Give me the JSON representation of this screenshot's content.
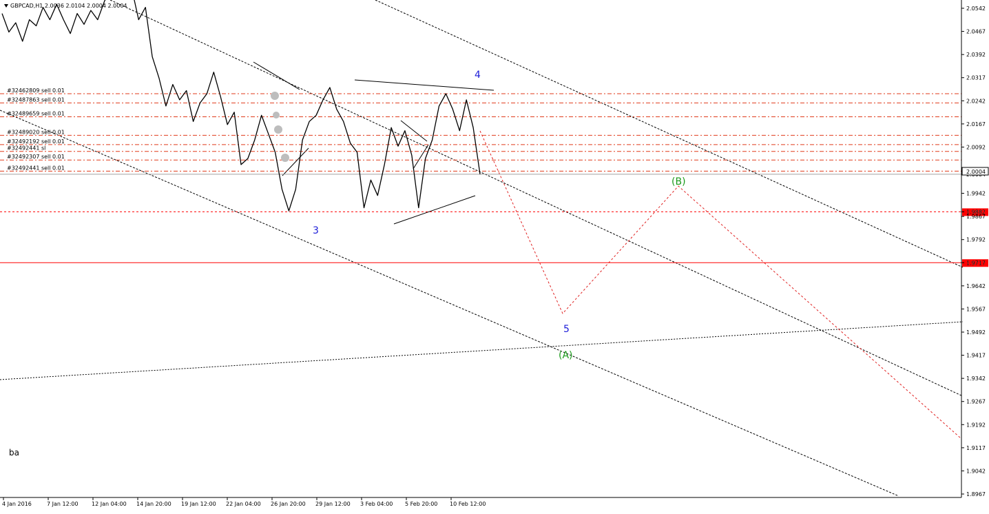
{
  "header": {
    "symbol_info": "GBPCAD,H1  2.0036 2.0104 2.0004 2.0004"
  },
  "note": "ba",
  "colors": {
    "background": "#ffffff",
    "price": "#000000",
    "order_line": "#e03a1a",
    "level_line": "#ff0000",
    "wave_blue": "#1c1cd8",
    "wave_green": "#1a9a1a",
    "projection": "#e02020"
  },
  "chart_data": {
    "type": "line",
    "title": "",
    "symbol": "GBPCAD",
    "timeframe": "H1",
    "ohlc": {
      "open": 2.0036,
      "high": 2.0104,
      "low": 2.0004,
      "close": 2.0004
    },
    "ylim": [
      1.8967,
      2.0542
    ],
    "grid": false,
    "y_ticks": [
      "2.0542",
      "2.0467",
      "2.0392",
      "2.0317",
      "2.0242",
      "2.0167",
      "2.0092",
      "2.0004",
      "1.9942",
      "1.9882",
      "1.9867",
      "1.9792",
      "1.9717",
      "1.9642",
      "1.9567",
      "1.9492",
      "1.9417",
      "1.9342",
      "1.9267",
      "1.9192",
      "1.9117",
      "1.9042",
      "1.8967"
    ],
    "x_ticks": [
      "4 Jan 2016",
      "7 Jan 12:00",
      "12 Jan 04:00",
      "14 Jan 20:00",
      "19 Jan 12:00",
      "22 Jan 04:00",
      "26 Jan 20:00",
      "29 Jan 12:00",
      "3 Feb 04:00",
      "5 Feb 20:00",
      "10 Feb 12:00"
    ],
    "current_price": "2.0004",
    "price_series": [
      [
        "4 Jan 2016",
        2.0525
      ],
      [
        "5 Jan 00:00",
        2.0465
      ],
      [
        "5 Jan 12:00",
        2.0495
      ],
      [
        "6 Jan 00:00",
        2.0435
      ],
      [
        "6 Jan 12:00",
        2.0505
      ],
      [
        "7 Jan 12:00",
        2.0485
      ],
      [
        "8 Jan 00:00",
        2.0545
      ],
      [
        "8 Jan 12:00",
        2.0505
      ],
      [
        "11 Jan 00:00",
        2.0555
      ],
      [
        "11 Jan 12:00",
        2.0505
      ],
      [
        "12 Jan 04:00",
        2.046
      ],
      [
        "12 Jan 16:00",
        2.0525
      ],
      [
        "13 Jan 04:00",
        2.049
      ],
      [
        "13 Jan 16:00",
        2.0535
      ],
      [
        "14 Jan 20:00",
        2.0505
      ],
      [
        "15 Jan 08:00",
        2.0565
      ],
      [
        "15 Jan 20:00",
        2.0605
      ],
      [
        "18 Jan 00:00",
        2.0575
      ],
      [
        "18 Jan 12:00",
        2.0615
      ],
      [
        "19 Jan 12:00",
        2.0605
      ],
      [
        "20 Jan 00:00",
        2.0505
      ],
      [
        "20 Jan 04:00",
        2.0545
      ],
      [
        "20 Jan 08:00",
        2.0385
      ],
      [
        "20 Jan 16:00",
        2.0315
      ],
      [
        "21 Jan 00:00",
        2.0225
      ],
      [
        "21 Jan 08:00",
        2.0295
      ],
      [
        "21 Jan 16:00",
        2.0245
      ],
      [
        "22 Jan 04:00",
        2.0275
      ],
      [
        "22 Jan 12:00",
        2.0175
      ],
      [
        "22 Jan 20:00",
        2.0235
      ],
      [
        "25 Jan 00:00",
        2.0265
      ],
      [
        "25 Jan 08:00",
        2.0335
      ],
      [
        "25 Jan 16:00",
        2.0255
      ],
      [
        "25 Jan 20:00",
        2.0165
      ],
      [
        "26 Jan 04:00",
        2.0205
      ],
      [
        "26 Jan 12:00",
        2.0035
      ],
      [
        "26 Jan 20:00",
        2.0055
      ],
      [
        "27 Jan 04:00",
        2.0115
      ],
      [
        "27 Jan 12:00",
        2.0195
      ],
      [
        "27 Jan 20:00",
        2.0135
      ],
      [
        "28 Jan 04:00",
        2.0075
      ],
      [
        "28 Jan 12:00",
        1.9955
      ],
      [
        "28 Jan 20:00",
        1.9885
      ],
      [
        "29 Jan 12:00",
        1.9955
      ],
      [
        "1 Feb 00:00",
        2.0115
      ],
      [
        "1 Feb 08:00",
        2.0175
      ],
      [
        "1 Feb 16:00",
        2.0195
      ],
      [
        "2 Feb 00:00",
        2.0245
      ],
      [
        "2 Feb 08:00",
        2.0285
      ],
      [
        "2 Feb 16:00",
        2.0215
      ],
      [
        "3 Feb 04:00",
        2.0175
      ],
      [
        "3 Feb 12:00",
        2.0105
      ],
      [
        "3 Feb 20:00",
        2.0075
      ],
      [
        "4 Feb 04:00",
        1.9895
      ],
      [
        "4 Feb 12:00",
        1.9985
      ],
      [
        "4 Feb 20:00",
        1.9935
      ],
      [
        "5 Feb 04:00",
        2.0035
      ],
      [
        "5 Feb 12:00",
        2.0155
      ],
      [
        "5 Feb 20:00",
        2.0095
      ],
      [
        "8 Feb 00:00",
        2.0145
      ],
      [
        "8 Feb 08:00",
        2.0065
      ],
      [
        "8 Feb 16:00",
        1.9895
      ],
      [
        "9 Feb 00:00",
        2.0055
      ],
      [
        "9 Feb 08:00",
        2.0115
      ],
      [
        "9 Feb 16:00",
        2.0225
      ],
      [
        "10 Feb 00:00",
        2.0265
      ],
      [
        "10 Feb 08:00",
        2.0215
      ],
      [
        "10 Feb 12:00",
        2.0145
      ],
      [
        "10 Feb 20:00",
        2.0245
      ],
      [
        "11 Feb 00:00",
        2.0155
      ],
      [
        "11 Feb 04:00",
        2.0004
      ]
    ],
    "orders": [
      {
        "label": "#32462809 sell 0.01",
        "price": 2.0265
      },
      {
        "label": "#32487863 sell 0.01",
        "price": 2.0235
      },
      {
        "label": "#32489659 sell 0.01",
        "price": 2.019
      },
      {
        "label": "#32489020 sell 0.01",
        "price": 2.013
      },
      {
        "label": "#32492192 sell 0.01",
        "price": 2.01
      },
      {
        "label": "#32492441 sl",
        "price": 2.0078
      },
      {
        "label": "#32492307 sell 0.01",
        "price": 2.005
      },
      {
        "label": "#32492441 sell 0.01",
        "price": 2.0014
      }
    ],
    "levels": [
      {
        "label": "1.9882",
        "price": 1.9882,
        "style": "dashed"
      },
      {
        "label": "1.9717",
        "price": 1.9717,
        "style": "solid"
      }
    ],
    "wave_labels": [
      {
        "text": "4",
        "color": "blue"
      },
      {
        "text": "3",
        "color": "blue"
      },
      {
        "text": "5",
        "color": "blue"
      },
      {
        "text": "(A)",
        "color": "green"
      },
      {
        "text": "(B)",
        "color": "green"
      }
    ]
  }
}
